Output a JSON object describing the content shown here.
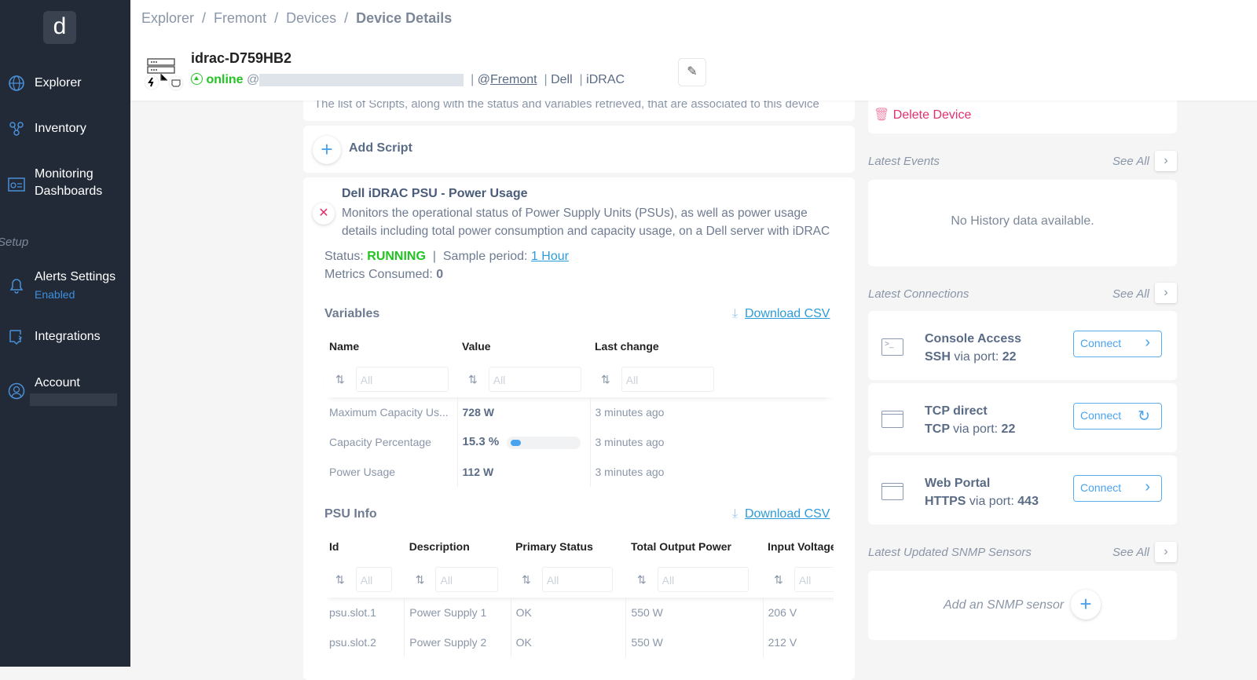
{
  "sidebar": {
    "logo": "d",
    "items": [
      {
        "label": "Explorer",
        "icon": "globe-icon"
      },
      {
        "label": "Inventory",
        "icon": "network-icon"
      },
      {
        "label": "Monitoring Dashboards",
        "icon": "dashboard-icon"
      }
    ],
    "setup_label": "Setup",
    "setup_items": [
      {
        "label": "Alerts Settings",
        "sub": "Enabled",
        "icon": "bell-icon"
      },
      {
        "label": "Integrations",
        "icon": "integration-icon"
      },
      {
        "label": "Account",
        "icon": "user-icon"
      }
    ]
  },
  "breadcrumb": [
    "Explorer",
    "Fremont",
    "Devices",
    "Device Details"
  ],
  "device": {
    "name": "idrac-D759HB2",
    "status": "online",
    "at": "@",
    "site_prefix": "@",
    "site": "Fremont",
    "vendor": "Dell",
    "type": "iDRAC"
  },
  "scripts": {
    "description": "The list of Scripts, along with the status and variables retrieved, that are associated to this device",
    "add_label": "Add Script",
    "script": {
      "title": "Dell iDRAC PSU - Power Usage",
      "description": "Monitors the operational status of Power Supply Units (PSUs), as well as power usage details including total power consumption and capacity usage, on a Dell server with iDRAC",
      "status_label": "Status:",
      "status": "RUNNING",
      "sample_label": "Sample period:",
      "sample": "1 Hour",
      "metrics_label": "Metrics Consumed:",
      "metrics": "0"
    }
  },
  "variables": {
    "title": "Variables",
    "download": "Download CSV",
    "columns": [
      "Name",
      "Value",
      "Last change"
    ],
    "filter_placeholder": "All",
    "rows": [
      {
        "name": "Maximum Capacity Us...",
        "value": "728 W",
        "last": "3 minutes ago"
      },
      {
        "name": "Capacity Percentage",
        "value": "15.3 %",
        "progress": 15.3,
        "last": "3 minutes ago"
      },
      {
        "name": "Power Usage",
        "value": "112 W",
        "last": "3 minutes ago"
      }
    ]
  },
  "psu": {
    "title": "PSU Info",
    "download": "Download CSV",
    "columns": [
      "Id",
      "Description",
      "Primary Status",
      "Total Output Power",
      "Input Voltage"
    ],
    "rows": [
      [
        "psu.slot.1",
        "Power Supply 1",
        "OK",
        "550 W",
        "206 V"
      ],
      [
        "psu.slot.2",
        "Power Supply 2",
        "OK",
        "550 W",
        "212 V"
      ]
    ]
  },
  "right": {
    "delete": "Delete Device",
    "events": {
      "title": "Latest Events",
      "see_all": "See All",
      "empty": "No History data available."
    },
    "connections": {
      "title": "Latest Connections",
      "see_all": "See All",
      "items": [
        {
          "title": "Console Access",
          "proto": "SSH",
          "via": "via port:",
          "port": "22",
          "button": "Connect",
          "icon": "terminal-icon",
          "action": "chevron-right-icon"
        },
        {
          "title": "TCP direct",
          "proto": "TCP",
          "via": "via port:",
          "port": "22",
          "button": "Connect",
          "icon": "window-icon",
          "action": "refresh-icon"
        },
        {
          "title": "Web Portal",
          "proto": "HTTPS",
          "via": "via port:",
          "port": "443",
          "button": "Connect",
          "icon": "window-icon",
          "action": "chevron-right-icon"
        }
      ]
    },
    "snmp": {
      "title": "Latest Updated SNMP Sensors",
      "see_all": "See All",
      "add": "Add an SNMP sensor"
    }
  },
  "colors": {
    "sidebar": "#222a37",
    "accent": "#2d9cdb",
    "online": "#22c322",
    "running": "#22c322",
    "delete": "#e0306f"
  }
}
